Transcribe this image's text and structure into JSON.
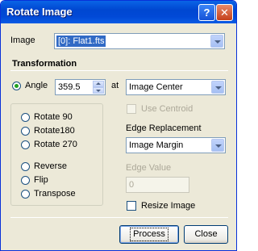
{
  "window": {
    "title": "Rotate Image",
    "help_glyph": "?",
    "close_glyph": "✕"
  },
  "image": {
    "label": "Image",
    "selected": "[0]: Flat1.fts"
  },
  "transformation": {
    "heading": "Transformation",
    "angle_label": "Angle",
    "angle_value": "359.5",
    "at_label": "at",
    "center_selected": "Image Center",
    "use_centroid_label": "Use Centroid",
    "options": [
      {
        "label": "Rotate 90"
      },
      {
        "label": "Rotate180"
      },
      {
        "label": "Rotate 270"
      },
      {
        "label": "Reverse"
      },
      {
        "label": "Flip"
      },
      {
        "label": "Transpose"
      }
    ],
    "edge_replacement_label": "Edge Replacement",
    "edge_replacement_selected": "Image Margin",
    "edge_value_label": "Edge Value",
    "edge_value": "0",
    "resize_label": "Resize Image"
  },
  "buttons": {
    "process": "Process",
    "close": "Close"
  }
}
